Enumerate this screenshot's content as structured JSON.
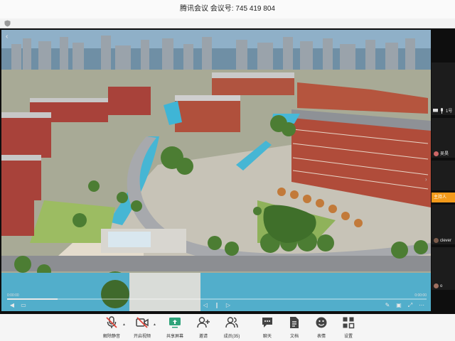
{
  "window": {
    "title": "腾讯会议 会议号: 745 419 804"
  },
  "share": {
    "time_left": "0:00:00",
    "time_right": "0:00:00",
    "progress": 0.12
  },
  "participants": [
    {
      "name": "1号"
    },
    {
      "name": "吴昊"
    },
    {
      "name": "clever"
    },
    {
      "name": "o"
    }
  ],
  "host_label": "主持人",
  "toolbar": {
    "unmute": "解除静音",
    "start_video": "开启视频",
    "share_screen": "共享屏幕",
    "invite": "邀请",
    "members": "成员(35)",
    "chat": "聊天",
    "docs": "文档",
    "emoji": "表情",
    "settings": "设置"
  },
  "colors": {
    "accent_green": "#2fa37a",
    "host_orange": "#f39a1a",
    "mute_red": "#e0453a"
  }
}
